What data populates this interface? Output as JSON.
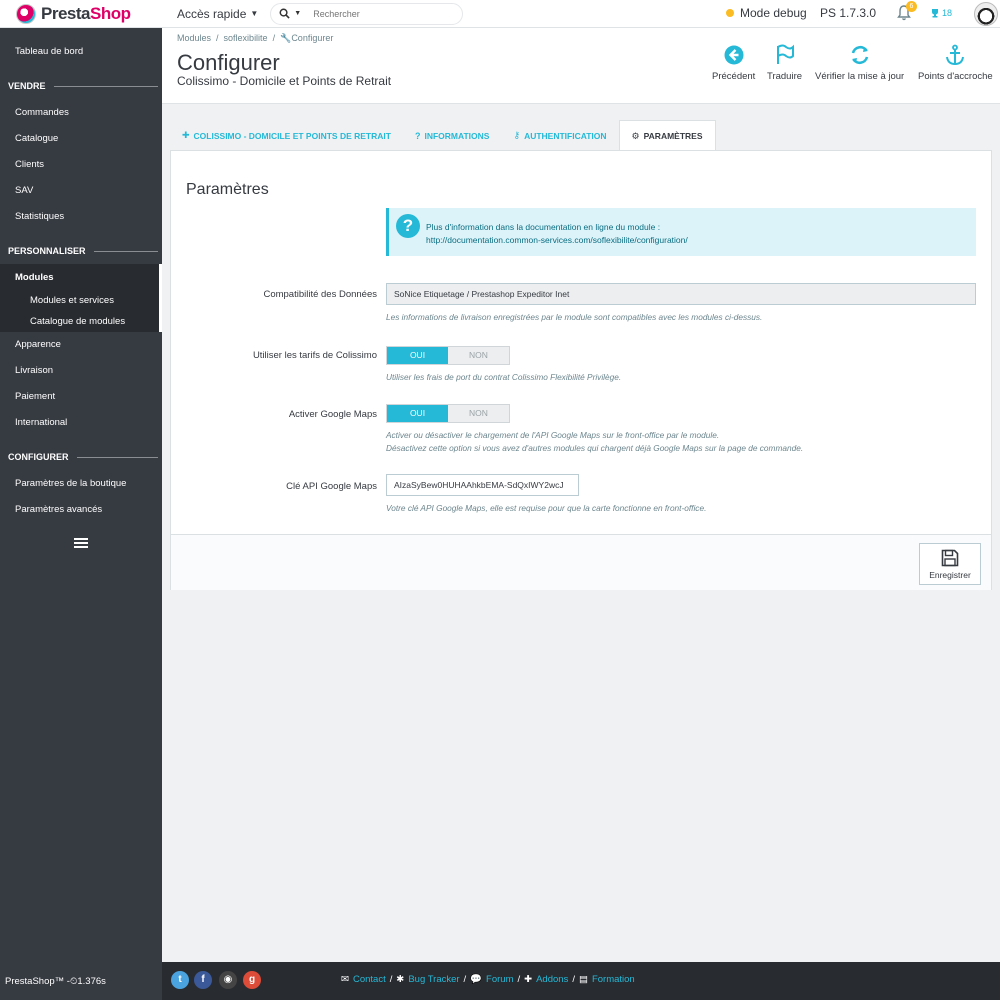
{
  "header": {
    "logo_text_a": "Presta",
    "logo_text_b": "Shop",
    "quick_access": "Accès rapide",
    "search_placeholder": "Rechercher",
    "debug_mode": "Mode debug",
    "version": "PS 1.7.3.0",
    "notifications_count": "6",
    "trophy_count": "18"
  },
  "sidebar": {
    "dashboard": "Tableau de bord",
    "section_sell": "VENDRE",
    "orders": "Commandes",
    "catalog": "Catalogue",
    "customers": "Clients",
    "sav": "SAV",
    "stats": "Statistiques",
    "section_customize": "PERSONNALISER",
    "modules": "Modules",
    "modules_services": "Modules et services",
    "modules_catalog": "Catalogue de modules",
    "appearance": "Apparence",
    "shipping": "Livraison",
    "payment": "Paiement",
    "international": "International",
    "section_configure": "CONFIGURER",
    "shop_params": "Paramètres de la boutique",
    "advanced_params": "Paramètres avancés"
  },
  "breadcrumb": {
    "item1": "Modules",
    "item2": "soflexibilite",
    "item3": "Configurer"
  },
  "page": {
    "title": "Configurer",
    "subtitle": "Colissimo - Domicile et Points de Retrait"
  },
  "toolbar": {
    "back": "Précédent",
    "translate": "Traduire",
    "check_update": "Vérifier la mise à jour",
    "hooks": "Points d'accroche"
  },
  "tabs": {
    "tab1": "COLISSIMO - DOMICILE ET POINTS DE RETRAIT",
    "tab2": "INFORMATIONS",
    "tab3": "AUTHENTIFICATION",
    "tab4": "PARAMÈTRES"
  },
  "panel": {
    "title": "Paramètres",
    "info_line1": "Plus d'information dans la documentation en ligne du module :",
    "info_line2": "http://documentation.common-services.com/soflexibilite/configuration/",
    "compat_label": "Compatibilité des Données",
    "compat_value": "SoNice Etiquetage / Prestashop Expeditor Inet",
    "compat_help": "Les informations de livraison enregistrées par le module sont compatibles avec les modules ci-dessus.",
    "tarifs_label": "Utiliser les tarifs de Colissimo",
    "tarifs_help": "Utiliser les frais de port du contrat Colissimo Flexibilité Privilège.",
    "maps_label": "Activer Google Maps",
    "maps_help1": "Activer ou désactiver le chargement de l'API Google Maps sur le front-office par le module.",
    "maps_help2": "Désactivez cette option si vous avez d'autres modules qui chargent déjà Google Maps sur la page de commande.",
    "api_label": "Clé API Google Maps",
    "api_value": "AIzaSyBew0HUHAAhkbEMA-SdQxIWY2wcJ",
    "api_help": "Votre clé API Google Maps, elle est requise pour que la carte fonctionne en front-office.",
    "switch_on": "OUI",
    "switch_off": "NON",
    "save": "Enregistrer"
  },
  "footer": {
    "brand": "PrestaShop™ - ",
    "load_time": "1.376s",
    "contact": "Contact",
    "bug_tracker": "Bug Tracker",
    "forum": "Forum",
    "addons": "Addons",
    "formation": "Formation",
    "slash": "/"
  },
  "colors": {
    "accent": "#25b9d7",
    "sidebar": "#363a41",
    "debug": "#fbbb22"
  }
}
